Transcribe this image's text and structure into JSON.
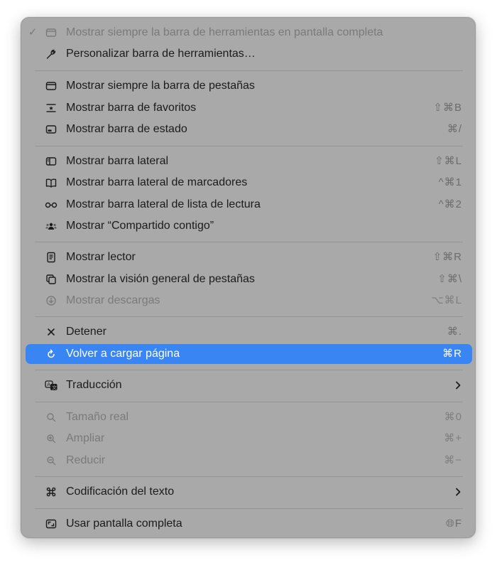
{
  "menu": {
    "items": [
      {
        "label": "Mostrar siempre la barra de herramientas en pantalla completa",
        "icon": "toolbar-icon",
        "check": "✓",
        "shortcut": ""
      },
      {
        "label": "Personalizar barra de herramientas…",
        "icon": "wrench-icon",
        "shortcut": ""
      },
      {
        "label": "Mostrar siempre la barra de pestañas",
        "icon": "tab-bar-icon",
        "shortcut": ""
      },
      {
        "label": "Mostrar barra de favoritos",
        "icon": "favorites-bar-icon",
        "shortcut": "⇧⌘B"
      },
      {
        "label": "Mostrar barra de estado",
        "icon": "status-bar-icon",
        "shortcut": "⌘/"
      },
      {
        "label": "Mostrar barra lateral",
        "icon": "sidebar-icon",
        "shortcut": "⇧⌘L"
      },
      {
        "label": "Mostrar barra lateral de marcadores",
        "icon": "book-icon",
        "shortcut": "^⌘1"
      },
      {
        "label": "Mostrar barra lateral de lista de lectura",
        "icon": "glasses-icon",
        "shortcut": "^⌘2"
      },
      {
        "label": "Mostrar “Compartido contigo”",
        "icon": "people-icon",
        "shortcut": ""
      },
      {
        "label": "Mostrar lector",
        "icon": "reader-icon",
        "shortcut": "⇧⌘R"
      },
      {
        "label": "Mostrar la visión general de pestañas",
        "icon": "tab-overview-icon",
        "shortcut": "⇧⌘\\"
      },
      {
        "label": "Mostrar descargas",
        "icon": "download-icon",
        "shortcut": "⌥⌘L"
      },
      {
        "label": "Detener",
        "icon": "close-icon",
        "shortcut": "⌘."
      },
      {
        "label": "Volver a cargar página",
        "icon": "reload-icon",
        "shortcut": "⌘R"
      },
      {
        "label": "Traducción",
        "icon": "translate-icon",
        "shortcut": ""
      },
      {
        "label": "Tamaño real",
        "icon": "zoom-icon",
        "shortcut": "⌘0"
      },
      {
        "label": "Ampliar",
        "icon": "zoom-in-icon",
        "shortcut": "⌘+"
      },
      {
        "label": "Reducir",
        "icon": "zoom-out-icon",
        "shortcut": "⌘−"
      },
      {
        "label": "Codificación del texto",
        "icon": "command-icon",
        "shortcut": ""
      },
      {
        "label": "Usar pantalla completa",
        "icon": "fullscreen-icon",
        "shortcut": "🌐︎F"
      }
    ],
    "highlight_color": "#3a85f4",
    "background_color": "#a9a9a9"
  }
}
